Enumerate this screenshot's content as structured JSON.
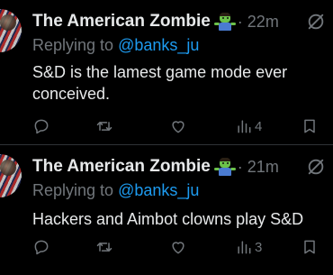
{
  "tweets": [
    {
      "author": "The American Zombie",
      "time": "· 22m",
      "reply_prefix": "Replying to ",
      "reply_handle": "@banks_ju",
      "text": "S&D is the lamest game mode ever conceived.",
      "views": "4"
    },
    {
      "author": "The American Zombie",
      "time": "· 21m",
      "reply_prefix": "Replying to ",
      "reply_handle": "@banks_ju",
      "text": "Hackers and Aimbot clowns play S&D",
      "views": "3"
    }
  ],
  "colors": {
    "background": "#000000",
    "text": "#e7e9ea",
    "muted": "#71767b",
    "link": "#1d9bf0",
    "divider": "#2f3336"
  },
  "icons": [
    "zombie-emoji-icon",
    "mute-icon",
    "reply-icon",
    "retweet-icon",
    "like-icon",
    "views-icon",
    "bookmark-icon"
  ]
}
